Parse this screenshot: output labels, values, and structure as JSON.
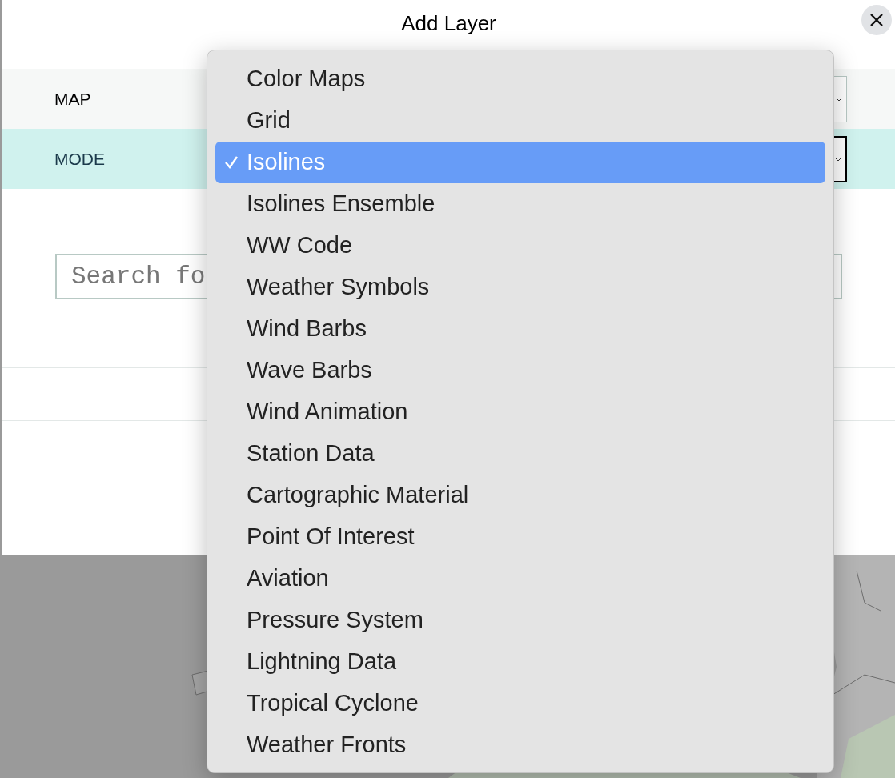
{
  "dialog": {
    "title": "Add Layer"
  },
  "fields": [
    {
      "label": "MAP",
      "focused": false
    },
    {
      "label": "MODE",
      "focused": true
    }
  ],
  "search": {
    "placeholder": "Search fo"
  },
  "dropdown": {
    "items": [
      {
        "label": "Color Maps",
        "selected": false
      },
      {
        "label": "Grid",
        "selected": false
      },
      {
        "label": "Isolines",
        "selected": true
      },
      {
        "label": "Isolines Ensemble",
        "selected": false
      },
      {
        "label": "WW Code",
        "selected": false
      },
      {
        "label": "Weather Symbols",
        "selected": false
      },
      {
        "label": "Wind Barbs",
        "selected": false
      },
      {
        "label": "Wave Barbs",
        "selected": false
      },
      {
        "label": "Wind Animation",
        "selected": false
      },
      {
        "label": "Station Data",
        "selected": false
      },
      {
        "label": "Cartographic Material",
        "selected": false
      },
      {
        "label": "Point Of Interest",
        "selected": false
      },
      {
        "label": "Aviation",
        "selected": false
      },
      {
        "label": "Pressure System",
        "selected": false
      },
      {
        "label": "Lightning Data",
        "selected": false
      },
      {
        "label": "Tropical Cyclone",
        "selected": false
      },
      {
        "label": "Weather Fronts",
        "selected": false
      }
    ]
  }
}
